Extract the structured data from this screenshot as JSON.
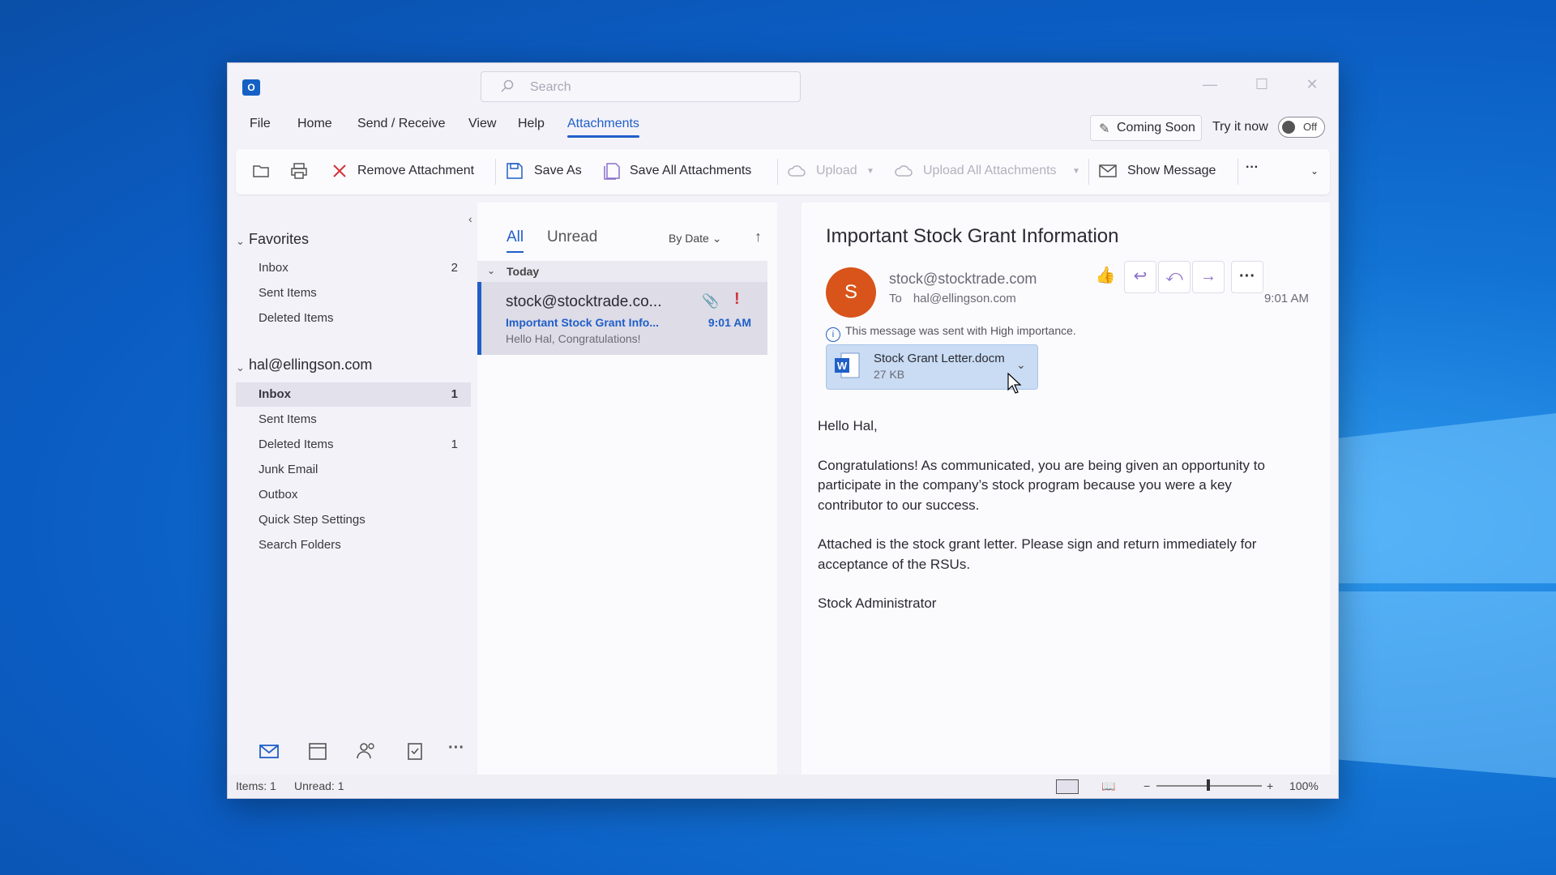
{
  "window": {
    "search_placeholder": "Search",
    "menu": [
      "File",
      "Home",
      "Send / Receive",
      "View",
      "Help",
      "Attachments"
    ],
    "active_menu": "Attachments",
    "coming_soon": "Coming Soon",
    "try_it_now": "Try it now",
    "toggle_state": "Off"
  },
  "ribbon": {
    "remove_attachment": "Remove Attachment",
    "save_as": "Save As",
    "save_all": "Save All Attachments",
    "upload": "Upload",
    "upload_all": "Upload All Attachments",
    "show_message": "Show Message",
    "more": "···"
  },
  "nav": {
    "favorites_header": "Favorites",
    "favorites": [
      {
        "label": "Inbox",
        "count": "2"
      },
      {
        "label": "Sent Items",
        "count": ""
      },
      {
        "label": "Deleted Items",
        "count": ""
      }
    ],
    "account_header": "hal@ellingson.com",
    "account_items": [
      {
        "label": "Inbox",
        "count": "1"
      },
      {
        "label": "Sent Items",
        "count": ""
      },
      {
        "label": "Deleted Items",
        "count": "1"
      },
      {
        "label": "Junk Email",
        "count": ""
      },
      {
        "label": "Outbox",
        "count": ""
      },
      {
        "label": "Quick Step Settings",
        "count": ""
      },
      {
        "label": "Search Folders",
        "count": ""
      }
    ]
  },
  "list": {
    "tab_all": "All",
    "tab_unread": "Unread",
    "sort": "By Date",
    "group": "Today",
    "message": {
      "from": "stock@stocktrade.co...",
      "subject": "Important Stock Grant Info...",
      "preview": "Hello Hal,  Congratulations!",
      "time": "9:01 AM",
      "importance": "!"
    }
  },
  "reading": {
    "subject": "Important Stock Grant Information",
    "avatar_letter": "S",
    "sender": "stock@stocktrade.com",
    "to_label": "To",
    "to": "hal@ellingson.com",
    "time": "9:01 AM",
    "importance_note": "This message was sent with High importance.",
    "attachment": {
      "name": "Stock Grant Letter.docm",
      "size": "27 KB"
    },
    "body": [
      "Hello Hal,",
      "Congratulations! As communicated, you are being given an opportunity to participate in the company’s stock program because you were a key contributor to our success.",
      "Attached is the stock grant letter. Please sign and return immediately for acceptance of the RSUs.",
      "Stock Administrator"
    ]
  },
  "status": {
    "items": "Items: 1",
    "unread": "Unread: 1",
    "zoom": "100%"
  },
  "colors": {
    "accent": "#1f5fc8",
    "avatar": "#d8541a",
    "importance": "#d13438"
  }
}
